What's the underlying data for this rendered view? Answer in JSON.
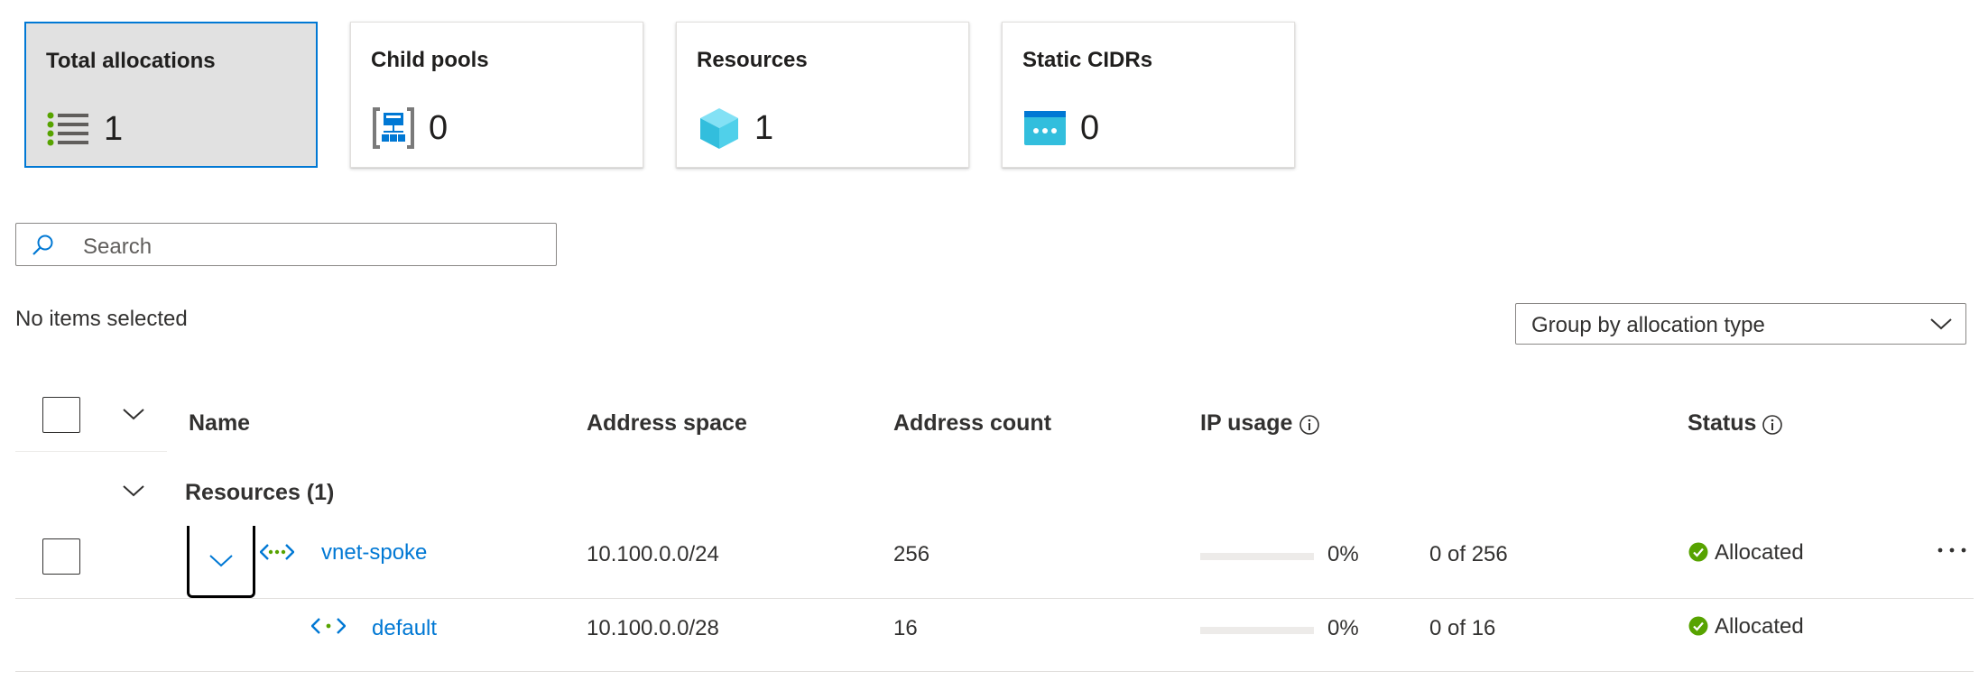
{
  "cards": [
    {
      "title": "Total allocations",
      "value": "1",
      "icon": "list-icon",
      "selected": true
    },
    {
      "title": "Child pools",
      "value": "0",
      "icon": "child-pool-icon",
      "selected": false
    },
    {
      "title": "Resources",
      "value": "1",
      "icon": "resource-cube-icon",
      "selected": false
    },
    {
      "title": "Static CIDRs",
      "value": "0",
      "icon": "static-cidr-icon",
      "selected": false
    }
  ],
  "search": {
    "placeholder": "Search"
  },
  "selection_status": "No items selected",
  "group_by": {
    "selected": "Group by allocation type"
  },
  "table": {
    "columns": {
      "name": "Name",
      "address_space": "Address space",
      "address_count": "Address count",
      "ip_usage": "IP usage",
      "status": "Status"
    },
    "group": {
      "label": "Resources (1)"
    },
    "rows": [
      {
        "name": "vnet-spoke",
        "address_space": "10.100.0.0/24",
        "address_count": "256",
        "usage_percent": "0%",
        "usage_fraction": 0,
        "usage_text": "0 of 256",
        "status": "Allocated",
        "icon": "vnet-icon"
      },
      {
        "name": "default",
        "address_space": "10.100.0.0/28",
        "address_count": "16",
        "usage_percent": "0%",
        "usage_fraction": 0,
        "usage_text": "0 of 16",
        "status": "Allocated",
        "icon": "subnet-icon"
      }
    ]
  },
  "colors": {
    "accent": "#0078d4",
    "status_ok": "#57a300",
    "selected_card_bg": "#e1e1e1"
  }
}
